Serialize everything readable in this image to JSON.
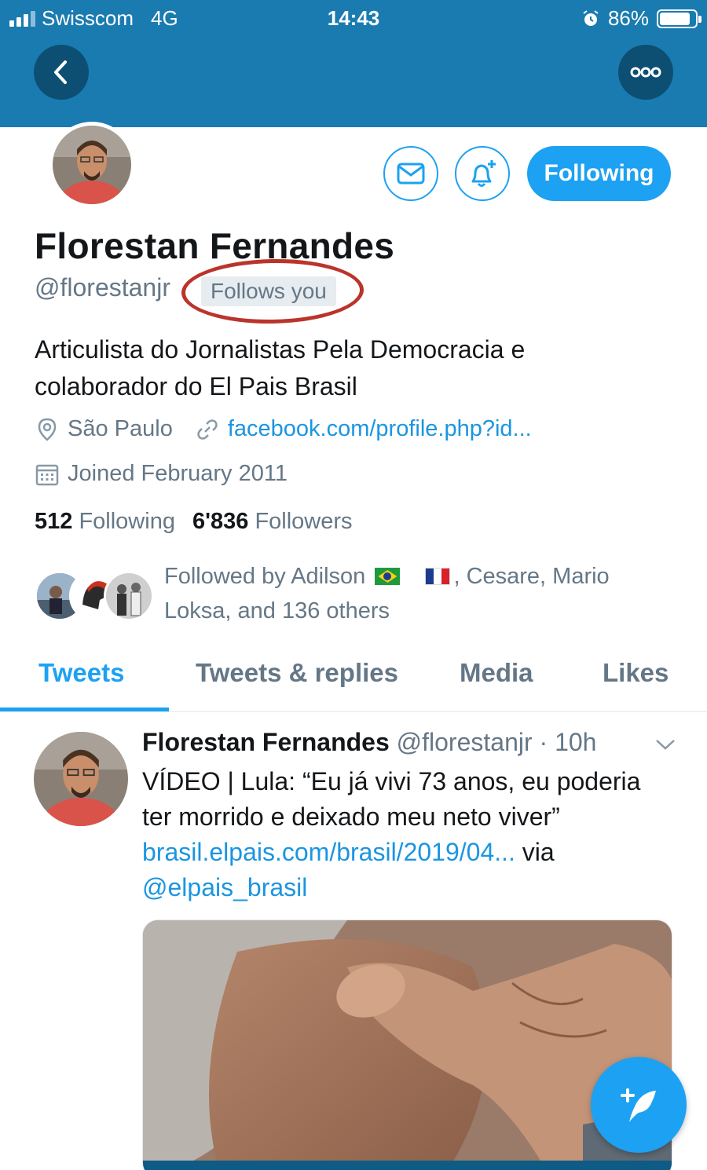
{
  "status_bar": {
    "carrier": "Swisscom",
    "network": "4G",
    "time": "14:43",
    "battery": "86%",
    "battery_level": 0.86
  },
  "header": {
    "back_icon": "chevron-left-icon",
    "more_icon": "more-dots-icon"
  },
  "profile": {
    "name": "Florestan Fernandes",
    "handle": "@florestanjr",
    "follows_you": "Follows you",
    "bio": "Articulista do Jornalistas Pela Democracia e colaborador do El Pais Brasil",
    "location": "São Paulo",
    "website": "facebook.com/profile.php?id...",
    "joined": "Joined February 2011",
    "following_count": "512",
    "following_label": "Following",
    "followers_count": "6'836",
    "followers_label": "Followers",
    "followed_by_prefix": "Followed by Adilson",
    "followed_by_suffix": ", Cesare, Mario Loksa, and 136 others",
    "follow_button": "Following"
  },
  "tabs": [
    {
      "label": "Tweets",
      "active": true
    },
    {
      "label": "Tweets & replies",
      "active": false
    },
    {
      "label": "Media",
      "active": false
    },
    {
      "label": "Likes",
      "active": false
    }
  ],
  "tweet": {
    "name": "Florestan Fernandes",
    "handle": "@florestanjr",
    "time": "· 10h",
    "text_prefix": "VÍDEO | Lula: “Eu já vivi 73 anos, eu poderia ter morrido e deixado meu neto viver”",
    "link": "brasil.elpais.com/brasil/2019/04...",
    "via": "via",
    "mention": "@elpais_brasil"
  },
  "colors": {
    "banner": "#1a7bb0",
    "accent": "#1da1f2",
    "annotation": "#b41e14"
  }
}
